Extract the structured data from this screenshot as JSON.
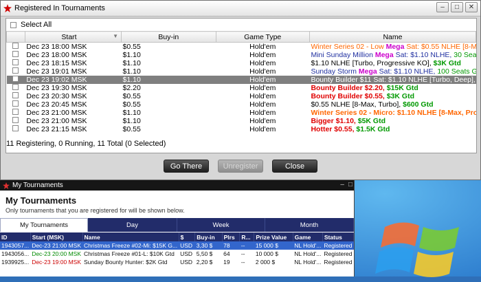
{
  "registered_window": {
    "title": "Registered In Tournaments",
    "select_all_label": "Select All",
    "columns": [
      "Start",
      "Buy-in",
      "Game Type",
      "Name"
    ],
    "rows": [
      {
        "start": "Dec 23  18:00 MSK",
        "buyin": "$0.55",
        "game": "Hold'em",
        "name_parts": [
          {
            "t": "Winter Series 02 - Low ",
            "c": "#ff6600",
            "b": false
          },
          {
            "t": "Mega",
            "c": "#cc00cc",
            "b": true
          },
          {
            "t": " Sat: $0.55 NLHE [8-Max],",
            "c": "#ff6600",
            "b": false
          }
        ]
      },
      {
        "start": "Dec 23  18:00 MSK",
        "buyin": "$1.10",
        "game": "Hold'em",
        "name_parts": [
          {
            "t": "Mini Sunday Million ",
            "c": "#1f2fa0",
            "b": false
          },
          {
            "t": "Mega",
            "c": "#cc00cc",
            "b": true
          },
          {
            "t": " Sat: $1.10 NLHE, ",
            "c": "#1f2fa0",
            "b": false
          },
          {
            "t": "30 Seats Gtd",
            "c": "#009900",
            "b": false
          }
        ]
      },
      {
        "start": "Dec 23  18:15 MSK",
        "buyin": "$1.10",
        "game": "Hold'em",
        "name_parts": [
          {
            "t": "$1.10 NLHE [Turbo, Progressive KO], ",
            "c": "#000000",
            "b": false
          },
          {
            "t": "$3K Gtd",
            "c": "#009900",
            "b": true
          }
        ]
      },
      {
        "start": "Dec 23  19:01 MSK",
        "buyin": "$1.10",
        "game": "Hold'em",
        "name_parts": [
          {
            "t": "Sunday Storm ",
            "c": "#1f2fa0",
            "b": false
          },
          {
            "t": "Mega",
            "c": "#cc00cc",
            "b": true
          },
          {
            "t": " Sat: $1.10 NLHE, ",
            "c": "#1f2fa0",
            "b": false
          },
          {
            "t": "100 Seats Gtd",
            "c": "#009900",
            "b": false
          }
        ]
      },
      {
        "start": "Dec 23  19:02 MSK",
        "buyin": "$1.10",
        "game": "Hold'em",
        "selected": true,
        "name_parts": [
          {
            "t": "Bounty Builder $11 Sat: $1.10 NLHE [Turbo, Deep], 40 Seat",
            "c": "#ffffff",
            "b": false
          }
        ]
      },
      {
        "start": "Dec 23  19:30 MSK",
        "buyin": "$2.20",
        "game": "Hold'em",
        "name_parts": [
          {
            "t": "Bounty Builder $2.20, ",
            "c": "#e00000",
            "b": true
          },
          {
            "t": "$15K Gtd",
            "c": "#009900",
            "b": true
          }
        ]
      },
      {
        "start": "Dec 23  20:30 MSK",
        "buyin": "$0.55",
        "game": "Hold'em",
        "name_parts": [
          {
            "t": "Bounty Builder $0.55, ",
            "c": "#e00000",
            "b": true
          },
          {
            "t": "$3K Gtd",
            "c": "#009900",
            "b": true
          }
        ]
      },
      {
        "start": "Dec 23  20:45 MSK",
        "buyin": "$0.55",
        "game": "Hold'em",
        "name_parts": [
          {
            "t": "$0.55 NLHE [8-Max, Turbo], ",
            "c": "#000000",
            "b": false
          },
          {
            "t": "$600 Gtd",
            "c": "#009900",
            "b": true
          }
        ]
      },
      {
        "start": "Dec 23  21:00 MSK",
        "buyin": "$1.10",
        "game": "Hold'em",
        "name_parts": [
          {
            "t": "Winter Series 02 - Micro: $1.10 NLHE [8-Max, Progressi",
            "c": "#ff6600",
            "b": true
          }
        ]
      },
      {
        "start": "Dec 23  21:00 MSK",
        "buyin": "$1.10",
        "game": "Hold'em",
        "name_parts": [
          {
            "t": "Bigger $1.10, ",
            "c": "#e00000",
            "b": true
          },
          {
            "t": "$5K Gtd",
            "c": "#009900",
            "b": true
          }
        ]
      },
      {
        "start": "Dec 23  21:15 MSK",
        "buyin": "$0.55",
        "game": "Hold'em",
        "name_parts": [
          {
            "t": "Hotter $0.55, ",
            "c": "#e00000",
            "b": true
          },
          {
            "t": "$1.5K Gtd",
            "c": "#009900",
            "b": true
          }
        ]
      }
    ],
    "status": "11 Registering, 0 Running, 11 Total (0 Selected)",
    "buttons": {
      "go_there": "Go There",
      "unregister": "Unregister",
      "close": "Close"
    }
  },
  "my_tournaments": {
    "window_title": "My Tournaments",
    "heading": "My Tournaments",
    "subtitle": "Only tournaments that you are registered for will be shown below.",
    "tabs": [
      "My Tournaments",
      "Day",
      "Week",
      "Month"
    ],
    "columns": [
      "ID",
      "Start (MSK)",
      "Name",
      "$",
      "Buy-in",
      "Plrs",
      "R...",
      "Prize Value",
      "Game",
      "Status"
    ],
    "rows": [
      {
        "id": "1943057...",
        "start": "Dec-23 21:00 MSK",
        "start_color": "#ffffff",
        "name": "Christmas Freeze #02-Mi: $15K G...",
        "cur": "USD",
        "buyin": "3,30 $",
        "plrs": "78",
        "r": "--",
        "prize": "15 000 $",
        "game": "NL Hold'...",
        "status": "Registered",
        "selected": true
      },
      {
        "id": "1943056...",
        "start": "Dec-23 20:00 MSK",
        "start_color": "#008a00",
        "name": "Christmas Freeze #01-L: $10K Gtd",
        "cur": "USD",
        "buyin": "5,50 $",
        "plrs": "64",
        "r": "--",
        "prize": "10 000 $",
        "game": "NL Hold'...",
        "status": "Registered"
      },
      {
        "id": "1939925...",
        "start": "Dec-23 19:00 MSK",
        "start_color": "#cc0000",
        "name": "Sunday Bounty Hunter: $2K Gtd",
        "cur": "USD",
        "buyin": "2,20 $",
        "plrs": "19",
        "r": "--",
        "prize": "2 000 $",
        "game": "NL Hold'...",
        "status": "Registered"
      }
    ]
  }
}
